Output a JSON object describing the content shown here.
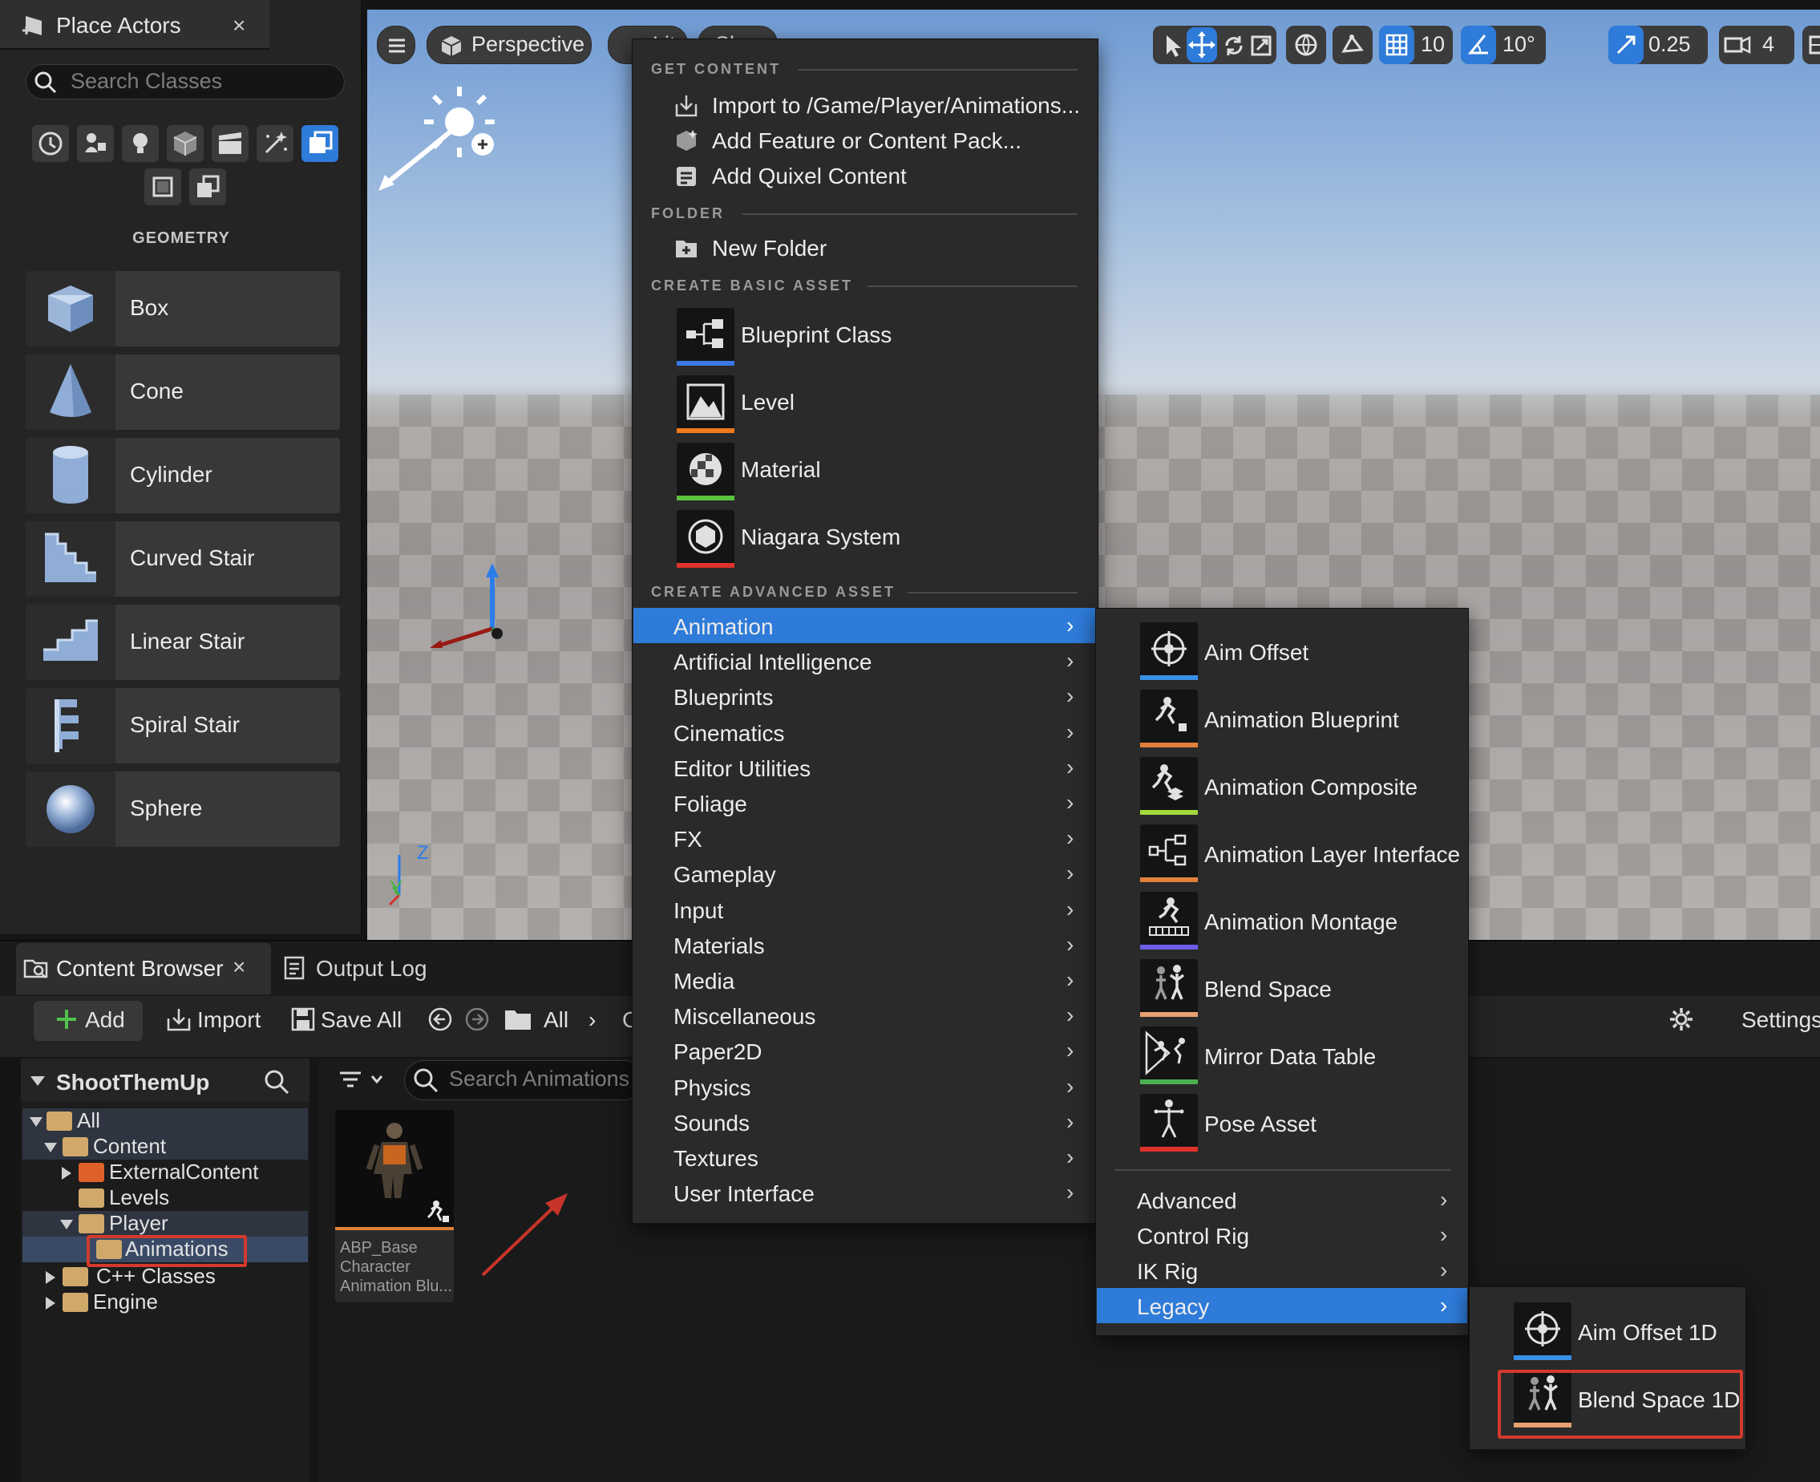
{
  "place_actors": {
    "tab_title": "Place Actors",
    "close": "×",
    "search_placeholder": "Search Classes",
    "section": "GEOMETRY",
    "items": [
      "Box",
      "Cone",
      "Cylinder",
      "Curved Stair",
      "Linear Stair",
      "Spiral Stair",
      "Sphere"
    ]
  },
  "viewport": {
    "perspective": "Perspective",
    "lit": "Lit",
    "show": "Show",
    "grid_snap": "10",
    "rotate_snap": "10°",
    "scale_snap": "0.25",
    "camera_speed": "4",
    "axis_z": "Z",
    "axis_y": "Y"
  },
  "context_menu": {
    "sections": {
      "get_content": "GET CONTENT",
      "folder": "FOLDER",
      "create_basic": "CREATE BASIC ASSET",
      "create_advanced": "CREATE ADVANCED ASSET"
    },
    "get_content": [
      "Import to /Game/Player/Animations...",
      "Add Feature or Content Pack...",
      "Add Quixel Content"
    ],
    "new_folder": "New Folder",
    "basic_assets": [
      {
        "label": "Blueprint Class",
        "color": "#3a78e6"
      },
      {
        "label": "Level",
        "color": "#f07a1c"
      },
      {
        "label": "Material",
        "color": "#5cc23d"
      },
      {
        "label": "Niagara System",
        "color": "#e0332b"
      }
    ],
    "advanced": [
      "Animation",
      "Artificial Intelligence",
      "Blueprints",
      "Cinematics",
      "Editor Utilities",
      "Foliage",
      "FX",
      "Gameplay",
      "Input",
      "Materials",
      "Media",
      "Miscellaneous",
      "Paper2D",
      "Physics",
      "Sounds",
      "Textures",
      "User Interface"
    ]
  },
  "animation_menu": {
    "assets": [
      {
        "label": "Aim Offset",
        "color": "#3a8fe6"
      },
      {
        "label": "Animation Blueprint",
        "color": "#e0803a"
      },
      {
        "label": "Animation Composite",
        "color": "#a3d93b"
      },
      {
        "label": "Animation Layer Interface",
        "color": "#e0803a"
      },
      {
        "label": "Animation Montage",
        "color": "#6b5de6"
      },
      {
        "label": "Blend Space",
        "color": "#e8a070"
      },
      {
        "label": "Mirror Data Table",
        "color": "#4caf50"
      },
      {
        "label": "Pose Asset",
        "color": "#e0332b"
      }
    ],
    "submenus": [
      "Advanced",
      "Control Rig",
      "IK Rig",
      "Legacy"
    ]
  },
  "legacy_menu": {
    "assets": [
      {
        "label": "Aim Offset 1D",
        "color": "#3a8fe6"
      },
      {
        "label": "Blend Space 1D",
        "color": "#e8a070"
      }
    ]
  },
  "content_browser": {
    "tab_title": "Content Browser",
    "close": "×",
    "output_log": "Output Log",
    "add": "Add",
    "import": "Import",
    "save_all": "Save All",
    "path_all": "All",
    "path_c": "C",
    "settings": "Settings",
    "tree_root": "ShootThemUp",
    "tree": [
      "All",
      "Content",
      "ExternalContent",
      "Levels",
      "Player",
      "Animations",
      "C++ Classes",
      "Engine"
    ],
    "search_placeholder": "Search Animations",
    "asset": {
      "line1": "ABP_Base",
      "line2": "Character",
      "line3": "Animation Blu..."
    }
  }
}
